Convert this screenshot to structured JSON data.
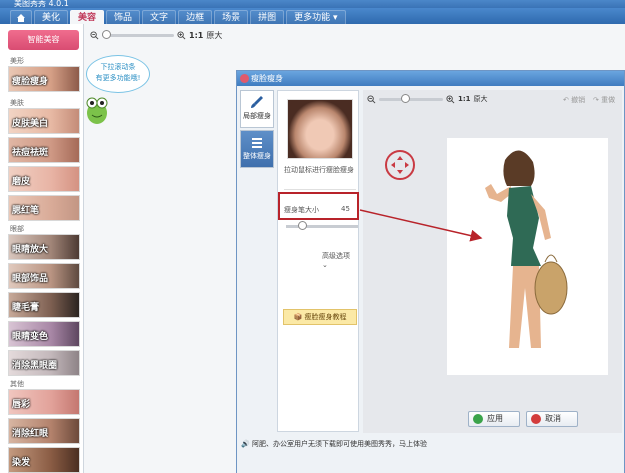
{
  "app": {
    "title": "美图秀秀 4.0.1"
  },
  "menu": {
    "tabs": [
      {
        "label": "美化"
      },
      {
        "label": "美容"
      },
      {
        "label": "饰品"
      },
      {
        "label": "文字"
      },
      {
        "label": "边框"
      },
      {
        "label": "场景"
      },
      {
        "label": "拼图"
      },
      {
        "label": "更多功能 ▾"
      }
    ],
    "active_index": 1
  },
  "left_panel": {
    "smart_button": "智能美容",
    "categories": {
      "body": "美形",
      "skin": "美肤",
      "eyes": "眼部",
      "other": "其他"
    },
    "features": [
      "瘦脸瘦身",
      "皮肤美白",
      "祛痘祛斑",
      "磨皮",
      "腮红笔",
      "眼睛放大",
      "眼部饰品",
      "睫毛膏",
      "眼睛变色",
      "消除黑眼圈",
      "唇彩",
      "消除红眼",
      "染发"
    ]
  },
  "main_toolbar": {
    "zoom_label": "1:1",
    "zoom_text": "原大"
  },
  "mascot": {
    "line1": "下拉滚动条",
    "line2": "有更多功能哦!"
  },
  "dialog": {
    "title": "瘦脸瘦身",
    "side_tabs": [
      {
        "label": "局部瘦身"
      },
      {
        "label": "整体瘦身"
      }
    ],
    "hint": "拉动鼠标进行瘦脸瘦身",
    "pen_size_label": "瘦身笔大小",
    "pen_size_value": "45",
    "advanced": "高级选项",
    "tutorial": "瘦脸瘦身教程",
    "zoom_label": "1:1",
    "zoom_text": "原大",
    "undo": "撤销",
    "redo": "重做",
    "ok": "应用",
    "cancel": "取消",
    "status": "阿肥、办公室用户无须下载即可使用美图秀秀，马上体验"
  },
  "colors": {
    "menu_blue": "#2f6aae",
    "accent_pink": "#d94c72",
    "annotation_red": "#b8232a",
    "swimsuit_green": "#2f6a55"
  }
}
